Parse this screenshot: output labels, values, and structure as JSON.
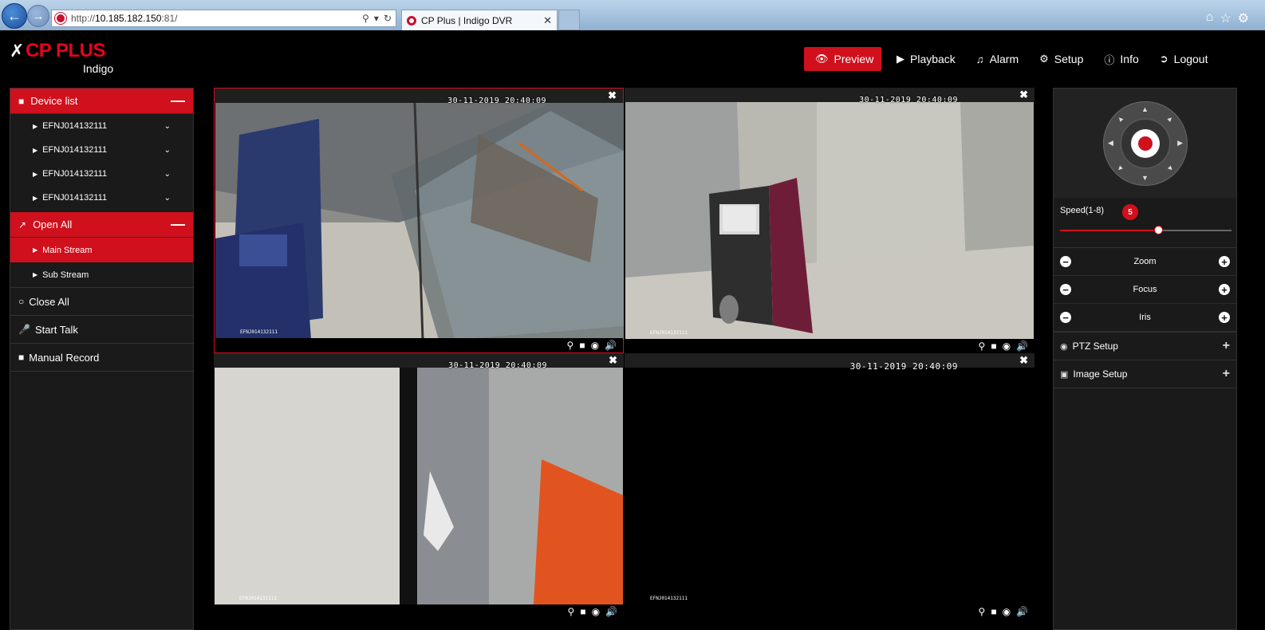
{
  "browser": {
    "url_prefix": "http://",
    "url_host": "10.185.182.150",
    "url_suffix": ":81/",
    "tab_title": "CP Plus | Indigo DVR"
  },
  "brand": {
    "name": "CP PLUS",
    "sub": "Indigo",
    "accent": "#d0101c"
  },
  "nav": [
    {
      "label": "Preview",
      "icon": "eye-icon",
      "active": true
    },
    {
      "label": "Playback",
      "icon": "play-icon"
    },
    {
      "label": "Alarm",
      "icon": "bell-icon"
    },
    {
      "label": "Setup",
      "icon": "gear-icon"
    },
    {
      "label": "Info",
      "icon": "info-icon"
    },
    {
      "label": "Logout",
      "icon": "logout-icon"
    }
  ],
  "left": {
    "device_list_label": "Device list",
    "devices": [
      "EFNJ014132111",
      "EFNJ014132111",
      "EFNJ014132111",
      "EFNJ014132111"
    ],
    "open_all_label": "Open All",
    "streams": [
      {
        "label": "Main Stream",
        "selected": true
      },
      {
        "label": "Sub Stream",
        "selected": false
      }
    ],
    "close_all_label": "Close All",
    "start_talk_label": "Start Talk",
    "manual_record_label": "Manual Record"
  },
  "videos": [
    {
      "timestamp": "30-11-2019 20:40:09",
      "camera_label": "EFNJ014132111",
      "active": true
    },
    {
      "timestamp": "30-11-2019 20:40:09",
      "camera_label": "EFNJ014132111",
      "active": false
    },
    {
      "timestamp": "30-11-2019 20:40:09",
      "camera_label": "EFNJ014132111",
      "active": false
    },
    {
      "timestamp": "30-11-2019 20:40:09",
      "camera_label": "EFNJ014132111",
      "active": false
    }
  ],
  "ptz": {
    "speed_label": "Speed(1-8)",
    "speed_value": "5",
    "speed_fraction": 0.57,
    "controls": [
      "Zoom",
      "Focus",
      "Iris"
    ],
    "ptz_setup_label": "PTZ Setup",
    "image_setup_label": "Image Setup"
  }
}
